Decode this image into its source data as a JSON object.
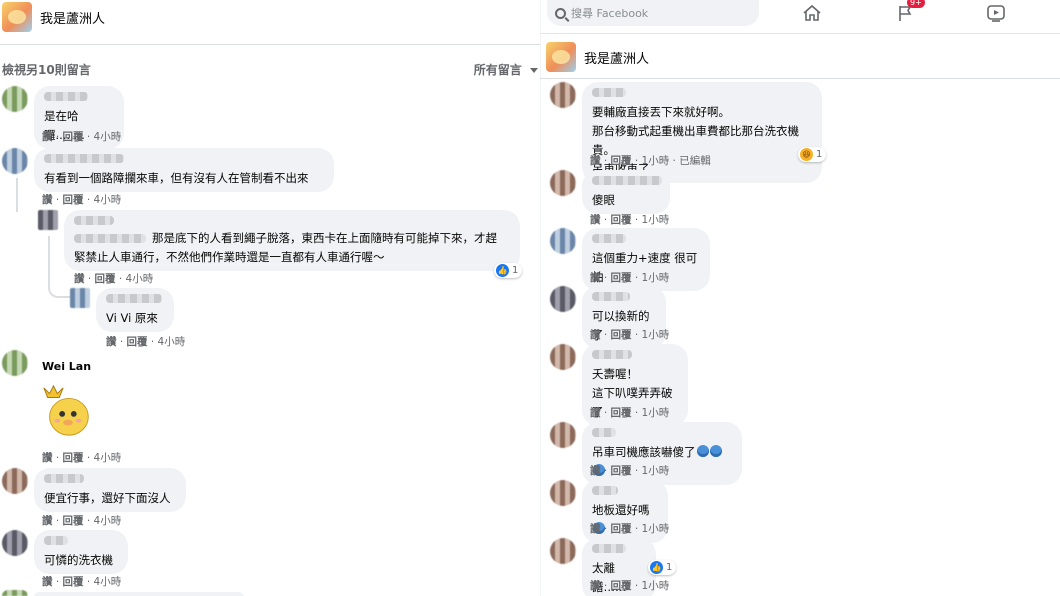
{
  "page": {
    "name": "我是蘆洲人"
  },
  "colors": {
    "link_blue": "#1877f2",
    "bubble_bg": "#f0f2f5",
    "meta_gray": "#65676b",
    "badge_red": "#e41e3f"
  },
  "left": {
    "view_more": "檢視另10則留言",
    "sort_label": "所有留言",
    "sort_icon": "caret-down-icon",
    "comments": [
      {
        "author": "",
        "text": "是在哈囉........",
        "actions": {
          "like": "讚",
          "reply": "回覆",
          "time": "4小時"
        }
      },
      {
        "author": "",
        "text": "有看到一個路障攔來車，但有沒有人在管制看不出來",
        "actions": {
          "like": "讚",
          "reply": "回覆",
          "time": "4小時"
        }
      },
      {
        "author": "",
        "text": "那是底下的人看到繩子脫落，東西卡在上面隨時有可能掉下來，才趕\n緊禁止人車通行，不然他們作業時還是一直都有人車通行喔～",
        "actions": {
          "like": "讚",
          "reply": "回覆",
          "time": "4小時"
        },
        "reaction_count": "1"
      },
      {
        "author": "",
        "text": "Vi Vi 原來",
        "actions": {
          "like": "讚",
          "reply": "回覆",
          "time": "4小時"
        }
      },
      {
        "author": "Wei Lan",
        "text": "",
        "actions": {
          "like": "讚",
          "reply": "回覆",
          "time": "4小時"
        }
      },
      {
        "author": "",
        "text": "便宜行事，還好下面沒人",
        "actions": {
          "like": "讚",
          "reply": "回覆",
          "time": "4小時"
        }
      },
      {
        "author": "",
        "text": "可憐的洗衣機",
        "actions": {
          "like": "讚",
          "reply": "回覆",
          "time": "4小時"
        }
      }
    ]
  },
  "right": {
    "search_placeholder": "搜尋 Facebook",
    "notification_badge": "9+",
    "nav_icons": [
      "home-icon",
      "flag-icon",
      "video-icon"
    ],
    "comments": [
      {
        "text": "要輔廠直接丟下來就好啊。\n那台移動式起重機出車費都比那台洗衣機貴。\n吊車收車了。",
        "actions": {
          "like": "讚",
          "reply": "回覆",
          "time": "1小時",
          "edited": "已編輯"
        },
        "reaction_count": "1"
      },
      {
        "text": "傻眼",
        "actions": {
          "like": "讚",
          "reply": "回覆",
          "time": "1小時"
        }
      },
      {
        "text": "這個重力+速度 很可怕",
        "actions": {
          "like": "讚",
          "reply": "回覆",
          "time": "1小時"
        }
      },
      {
        "text": "可以換新的了",
        "actions": {
          "like": "讚",
          "reply": "回覆",
          "time": "1小時"
        }
      },
      {
        "text": "夭壽喔！\n這下叭噗弄弄破了",
        "actions": {
          "like": "讚",
          "reply": "回覆",
          "time": "1小時"
        }
      },
      {
        "text": "吊車司機應該嚇傻了",
        "actions": {
          "like": "讚",
          "reply": "回覆",
          "time": "1小時"
        }
      },
      {
        "text": "地板還好嗎",
        "actions": {
          "like": "讚",
          "reply": "回覆",
          "time": "1小時"
        }
      },
      {
        "text": "太離譜……",
        "actions": {
          "like": "讚",
          "reply": "回覆",
          "time": "1小時"
        },
        "reaction_count": "1"
      }
    ]
  }
}
